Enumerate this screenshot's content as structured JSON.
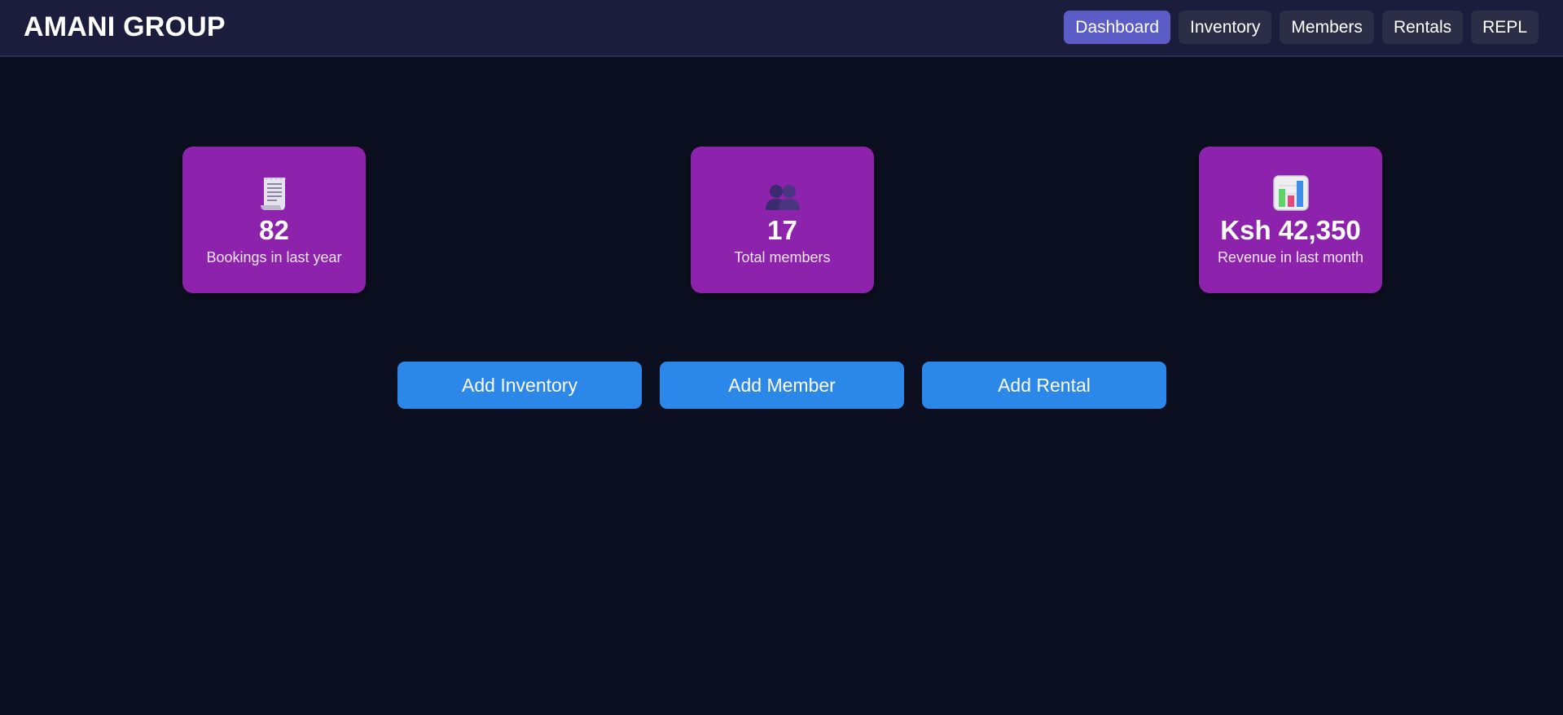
{
  "header": {
    "brand": "AMANI GROUP",
    "nav": [
      {
        "label": "Dashboard",
        "active": true
      },
      {
        "label": "Inventory",
        "active": false
      },
      {
        "label": "Members",
        "active": false
      },
      {
        "label": "Rentals",
        "active": false
      },
      {
        "label": "REPL",
        "active": false
      }
    ]
  },
  "stats": [
    {
      "icon": "receipt-icon",
      "value": "82",
      "label": "Bookings in last year"
    },
    {
      "icon": "members-icon",
      "value": "17",
      "label": "Total members"
    },
    {
      "icon": "bar-chart-icon",
      "value": "Ksh 42,350",
      "label": "Revenue in last month"
    }
  ],
  "actions": {
    "add_inventory": "Add Inventory",
    "add_member": "Add Member",
    "add_rental": "Add Rental"
  },
  "colors": {
    "background": "#0c0f1f",
    "header": "#1c1c3d",
    "card": "#8d23ad",
    "nav_active": "#5b5cc6",
    "nav_item": "#2c2d47",
    "button": "#2b87e8"
  }
}
